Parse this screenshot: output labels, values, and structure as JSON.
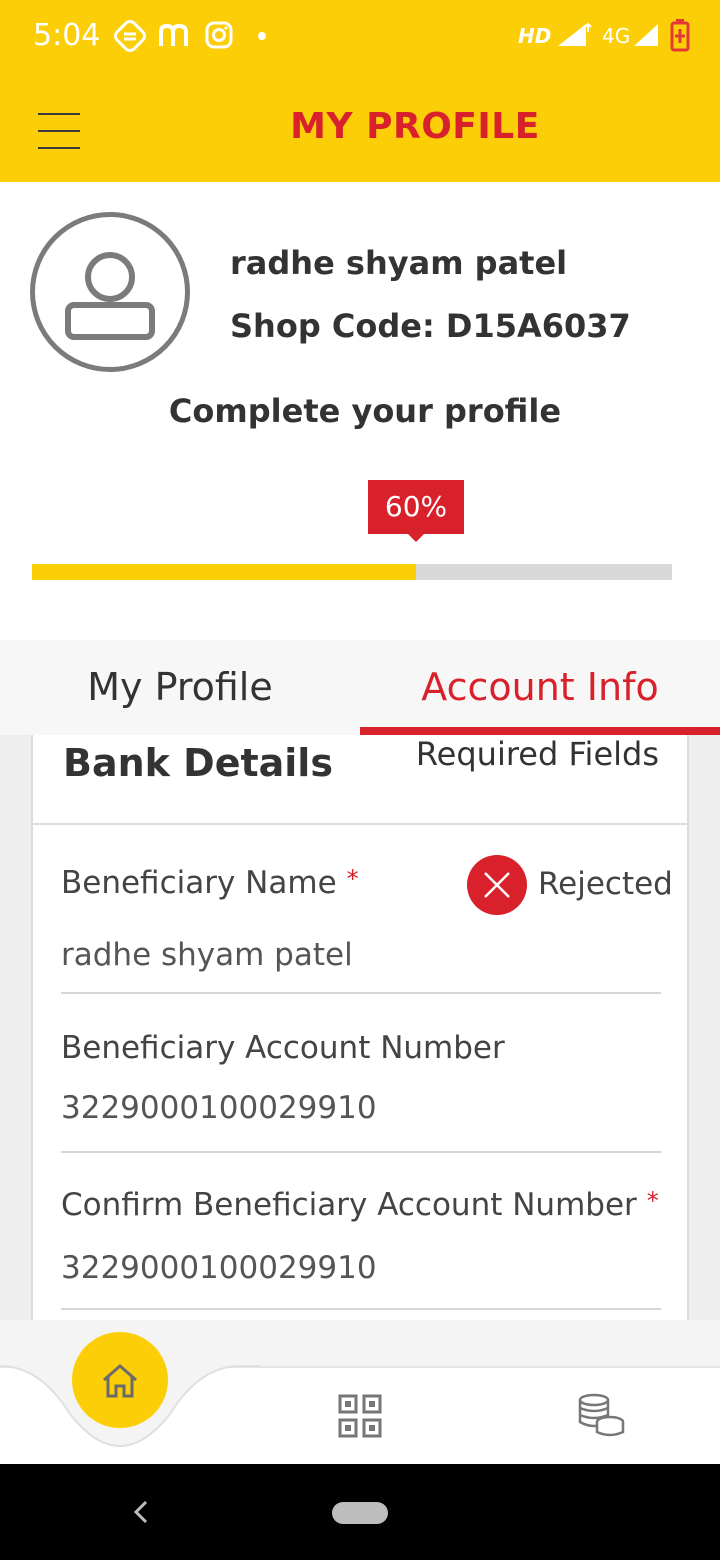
{
  "status_bar": {
    "time": "5:04",
    "network_label": "HD",
    "network_type": "4G",
    "icons": [
      "scooter-icon",
      "m-icon",
      "instagram-icon",
      "dot-icon",
      "signal-icon",
      "battery-icon"
    ]
  },
  "header": {
    "title": "MY PROFILE",
    "menu_icon": "hamburger-icon"
  },
  "profile": {
    "name": "radhe shyam patel",
    "shop_code": "Shop Code: D15A6037",
    "complete_label": "Complete your profile",
    "completion_percent": 60,
    "completion_label": "60%"
  },
  "tabs": [
    {
      "label": "My Profile",
      "active": false
    },
    {
      "label": "Account Info",
      "active": true
    }
  ],
  "bank_details": {
    "title": "Bank Details",
    "required_label": "Required Fields",
    "fields": [
      {
        "label": "Beneficiary Name",
        "value": "radhe shyam patel",
        "required": true,
        "status": "Rejected"
      },
      {
        "label": "Beneficiary Account Number",
        "value": "3229000100029910",
        "required": false
      },
      {
        "label": "Confirm Beneficiary Account Number",
        "value": "3229000100029910",
        "required": true
      }
    ]
  },
  "bottom_nav": {
    "items": [
      "home-icon",
      "qr-code-icon",
      "coins-icon"
    ]
  },
  "colors": {
    "brand_yellow": "#fcce07",
    "brand_red": "#d8212b",
    "text_dark": "#333333"
  }
}
